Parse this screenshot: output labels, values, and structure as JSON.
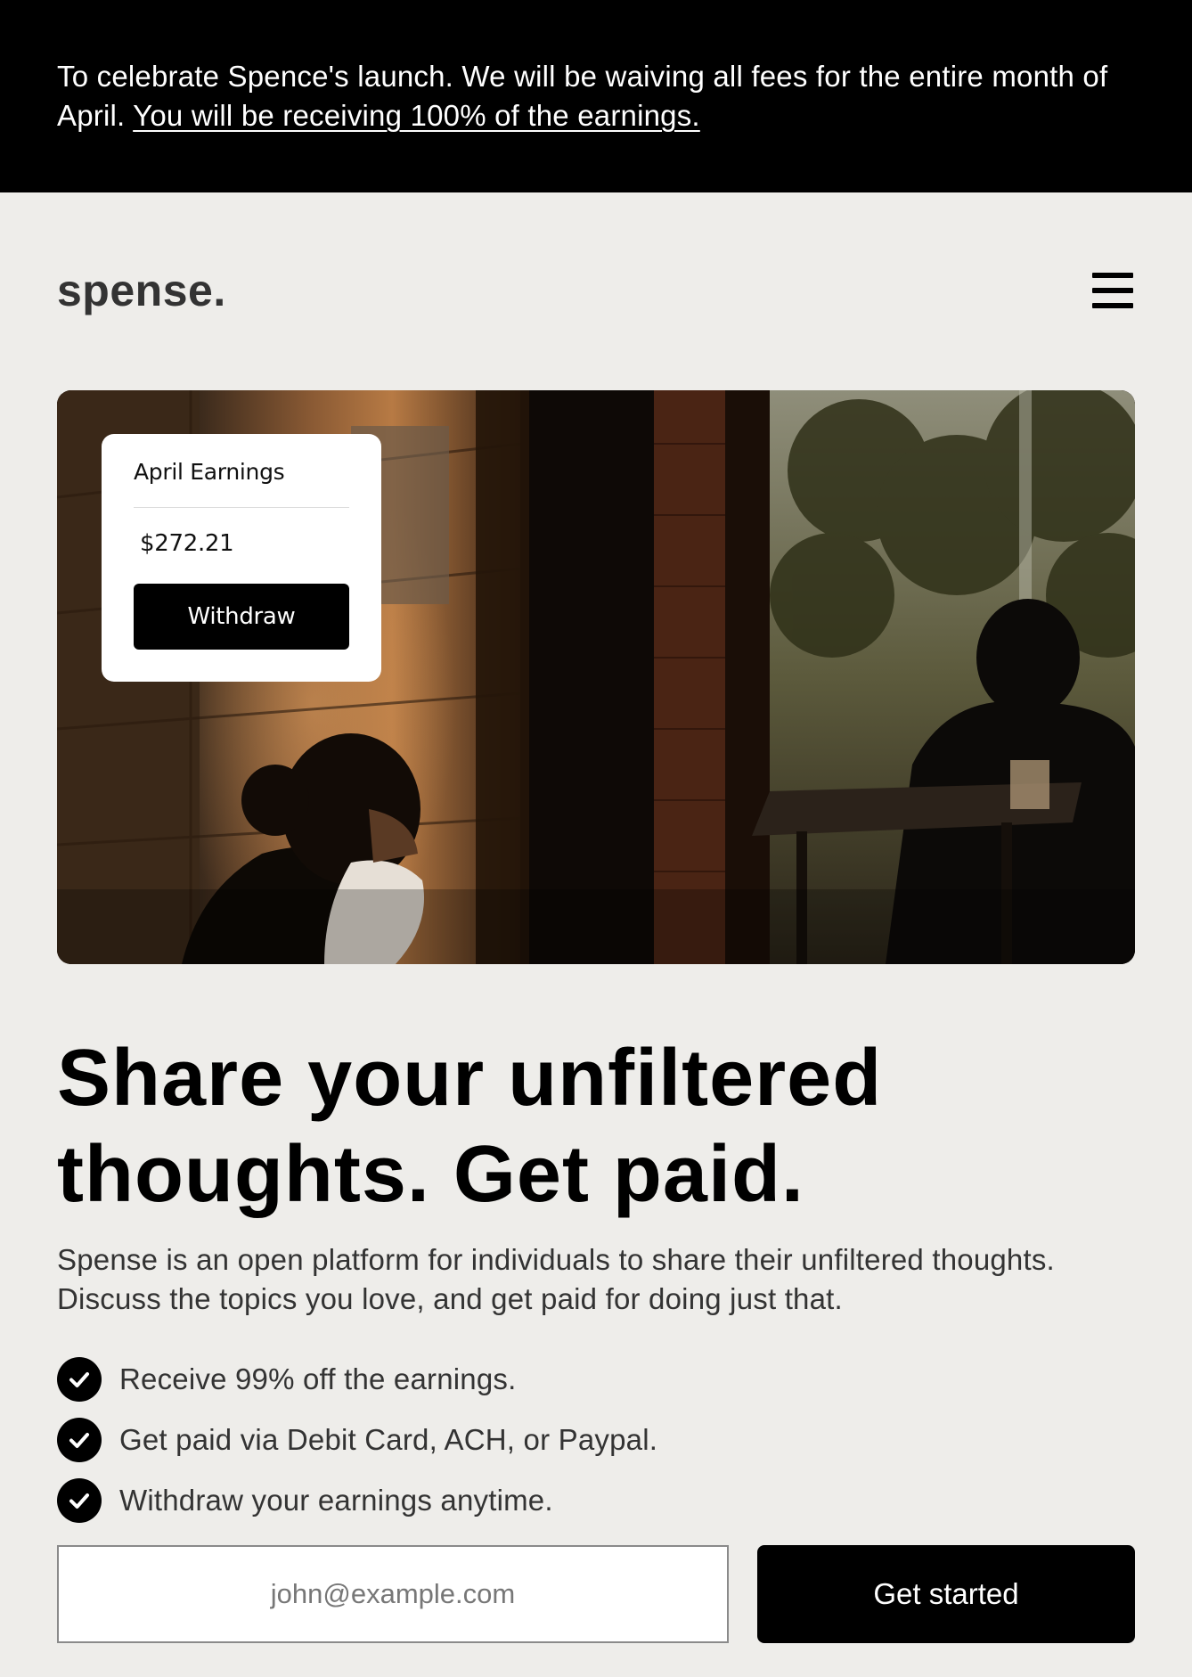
{
  "banner": {
    "text": "To celebrate Spence's launch. We will be waiving all fees for the entire month of April.",
    "link_text": "You will be receiving 100% of the earnings."
  },
  "header": {
    "logo": "spense.",
    "menu_icon": "hamburger-menu-icon"
  },
  "hero": {
    "image_subject": "photo of people in a dimly lit cafe",
    "earnings_card": {
      "title": "April Earnings",
      "amount": "$272.21",
      "button_label": "Withdraw"
    }
  },
  "main": {
    "headline_line1": "Share your unfiltered",
    "headline_line2": "thoughts. Get paid.",
    "description": "Spense is an open platform for individuals to share their unfiltered thoughts. Discuss the topics you love, and get paid for doing just that.",
    "features": [
      {
        "icon": "check-circle-icon",
        "text": "Receive 99% off the earnings."
      },
      {
        "icon": "check-circle-icon",
        "text": "Get paid via Debit Card, ACH, or Paypal."
      },
      {
        "icon": "check-circle-icon",
        "text": "Withdraw your earnings anytime."
      }
    ]
  },
  "signup": {
    "email_placeholder": "john@example.com",
    "email_value": "",
    "cta_label": "Get started"
  },
  "colors": {
    "background": "#eeedea",
    "banner_background": "#000000",
    "primary": "#000000",
    "text_muted": "#333333"
  }
}
